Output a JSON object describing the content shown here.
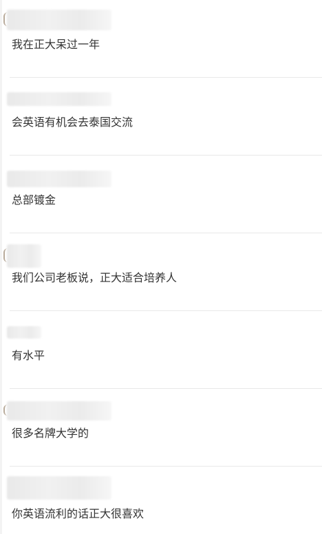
{
  "comments": [
    {
      "text": "我在正大呆过一年"
    },
    {
      "text": "会英语有机会去泰国交流"
    },
    {
      "text": "总部镀金"
    },
    {
      "text": "我们公司老板说，正大适合培养人"
    },
    {
      "text": "有水平"
    },
    {
      "text": "很多名牌大学的"
    },
    {
      "text": "你英语流利的话正大很喜欢"
    }
  ]
}
